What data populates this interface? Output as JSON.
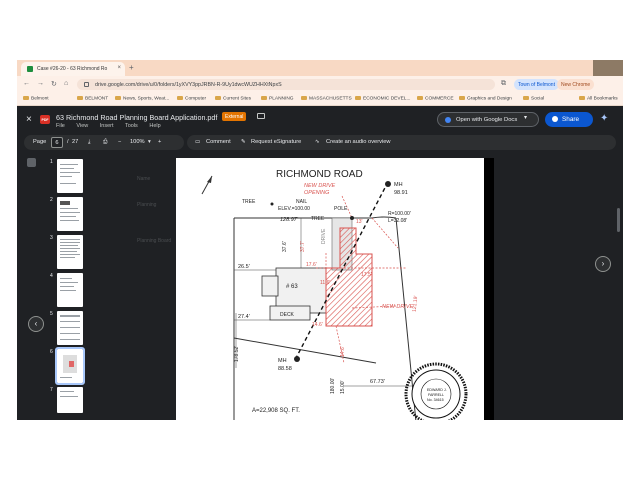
{
  "browser": {
    "tab_title": "Case #26-20 - 63 Richmond Ro",
    "tab_close": "×",
    "new_tab": "+",
    "url": "drive.google.com/drive/u/0/folders/1yXVY3ppJRBN-R-9Uy1dwcWUZHHXtNpxS",
    "profile_pill": "Town of Belmont",
    "chrome_pill": "New Chrome"
  },
  "bookmarks": [
    "Belmont",
    "BELMONT",
    "News, Sports, Weat...",
    "Computer",
    "Current Sites",
    "PLANNING",
    "MASSACHUSETTS",
    "ECONOMIC DEVEL...",
    "COMMERCE",
    "Graphics and Design",
    "Social",
    "All Bookmarks"
  ],
  "viewer": {
    "pdf_badge": "PDF",
    "title": "63 Richmond Road Planning Board Application.pdf",
    "external_badge": "External",
    "menu": [
      "File",
      "View",
      "Insert",
      "Tools",
      "Help"
    ],
    "open_with": "Open with Google Docs",
    "share": "Share",
    "close": "×"
  },
  "pdf_toolbar": {
    "page_label": "Page",
    "current_page": "6",
    "separator": "/",
    "total_pages": "27",
    "zoom": "100%",
    "zoom_out": "−",
    "zoom_in": "+"
  },
  "actions": {
    "comment": "Comment",
    "esign": "Request eSignature",
    "audio": "Create an audio overview"
  },
  "thumbnails": [
    "1",
    "2",
    "3",
    "4",
    "5",
    "6",
    "7"
  ],
  "selected_thumbnail": "6",
  "ghost_list": [
    "Name",
    "Planning",
    "Planning Board"
  ],
  "plan": {
    "road": "RICHMOND ROAD",
    "mh_top_label": "MH",
    "mh_top_value": "98.91",
    "new_drive_opening": "NEW DRIVE",
    "new_drive_opening2": "OPENING",
    "tree1": "TREE",
    "tree2": "TREE",
    "pole": "POLE",
    "nail": "NAIL",
    "elev": "ELEV.=100.00",
    "frontage": "128.97'",
    "radius": "R=100.00'",
    "arc": "L=32.08'",
    "dim_17": "17.6'",
    "dim_37": "37.6'",
    "dim_37b": "37.7'",
    "dim_26": "26.5'",
    "dim_27": "27.4'",
    "dim_17b": "17.5'",
    "dim_11": "11.6'",
    "dim_14": "14.6'",
    "dim_13": "13'",
    "dim_right": "121.19'",
    "dim_178": "178.52'",
    "dim_180": "180.00'",
    "dim_15": "15.00'",
    "dim_67": "67.73'",
    "house": "# 63",
    "deck": "DECK",
    "new_drive": "NEW DRIVE",
    "drive": "DRIVE",
    "mh_bottom_label": "MH",
    "mh_bottom_value": "88.58",
    "area": "A=22,908 SQ. FT.",
    "seal_name": "EDWARD J.",
    "seal_name2": "FARRELL",
    "seal_no": "No. 34615"
  }
}
